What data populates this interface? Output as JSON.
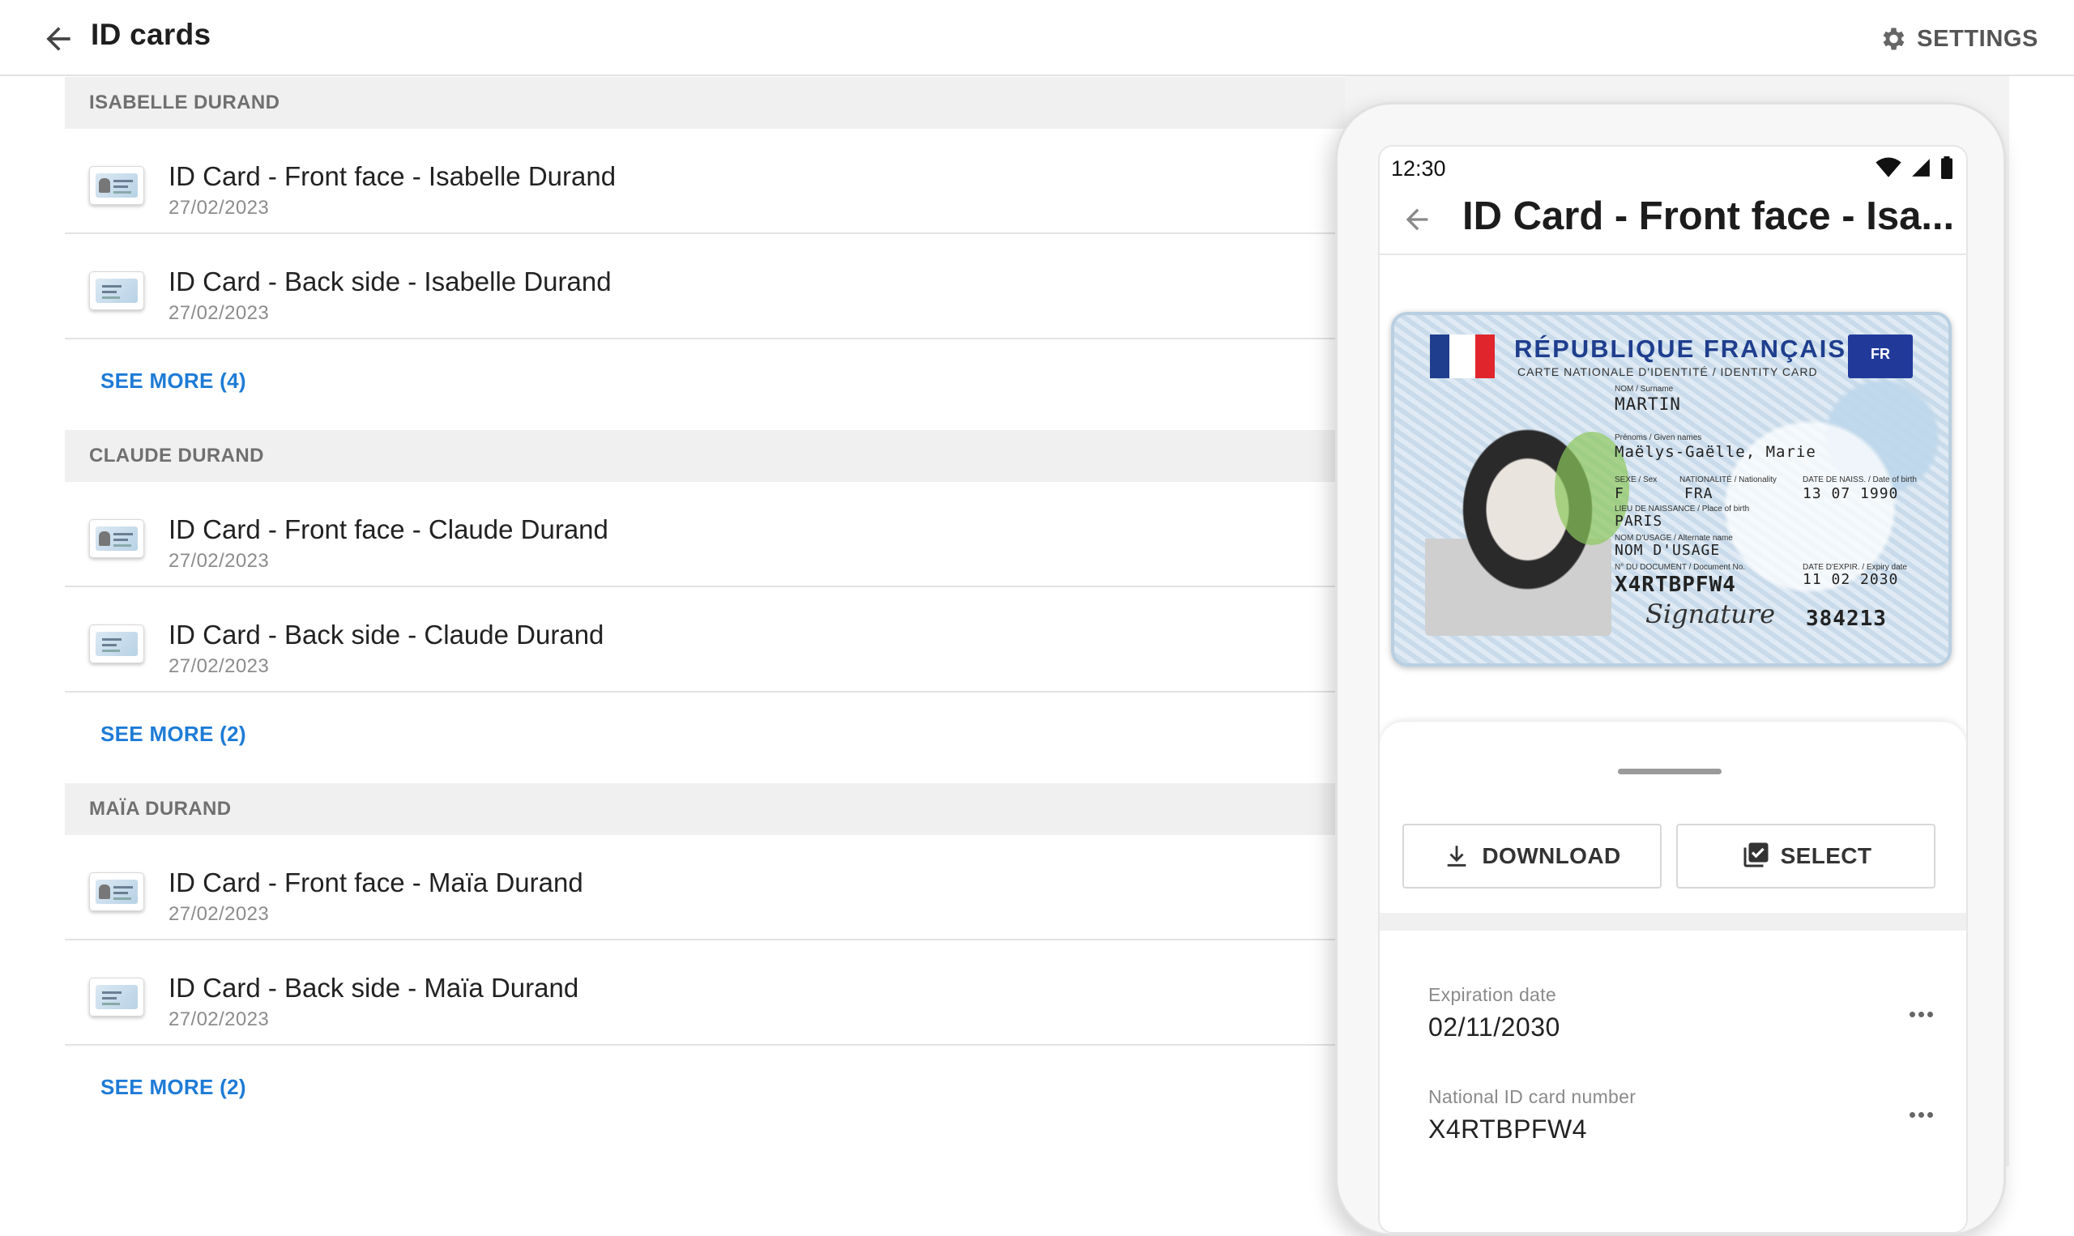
{
  "header": {
    "title": "ID cards",
    "settings_label": "SETTINGS"
  },
  "groups": [
    {
      "name": "ISABELLE DURAND",
      "items": [
        {
          "title": "ID Card - Front face - Isabelle Durand",
          "date": "27/02/2023"
        },
        {
          "title": "ID Card - Back side - Isabelle Durand",
          "date": "27/02/2023"
        }
      ],
      "see_more": "SEE MORE (4)"
    },
    {
      "name": "CLAUDE DURAND",
      "items": [
        {
          "title": "ID Card - Front face - Claude Durand",
          "date": "27/02/2023"
        },
        {
          "title": "ID Card - Back side - Claude Durand",
          "date": "27/02/2023"
        }
      ],
      "see_more": "SEE MORE (2)"
    },
    {
      "name": "MAÏA DURAND",
      "items": [
        {
          "title": "ID Card - Front face - Maïa Durand",
          "date": "27/02/2023"
        },
        {
          "title": "ID Card - Back side - Maïa Durand",
          "date": "27/02/2023"
        }
      ],
      "see_more": "SEE MORE (2)"
    }
  ],
  "phone": {
    "status_time": "12:30",
    "title": "ID Card - Front face - Isa...",
    "card": {
      "republic": "RÉPUBLIQUE FRANÇAISE",
      "card_type": "CARTE NATIONALE D'IDENTITÉ / IDENTITY CARD",
      "eu_code": "FR",
      "surname_label": "NOM / Surname",
      "surname": "MARTIN",
      "given_names_label": "Prénoms / Given names",
      "given_names": "Maëlys-Gaëlle, Marie",
      "sex_label": "SEXE / Sex",
      "sex": "F",
      "nationality_label": "NATIONALITÉ / Nationality",
      "nationality": "FRA",
      "birth_date_label": "DATE DE NAISS. / Date of birth",
      "birth_date": "13 07 1990",
      "birth_place_label": "LIEU DE NAISSANCE / Place of birth",
      "birth_place": "PARIS",
      "usage_name_label": "NOM D'USAGE / Alternate name",
      "usage_name": "NOM D'USAGE",
      "doc_no_label": "N° DU DOCUMENT / Document No.",
      "doc_no": "X4RTBPFW4",
      "expiry_label": "DATE D'EXPIR. / Expiry date",
      "expiry": "11 02 2030",
      "signature": "Signature",
      "code": "384213"
    },
    "download_label": "DOWNLOAD",
    "select_label": "SELECT",
    "fields": [
      {
        "label": "Expiration date",
        "value": "02/11/2030"
      },
      {
        "label": "National ID card number",
        "value": "X4RTBPFW4"
      }
    ]
  }
}
